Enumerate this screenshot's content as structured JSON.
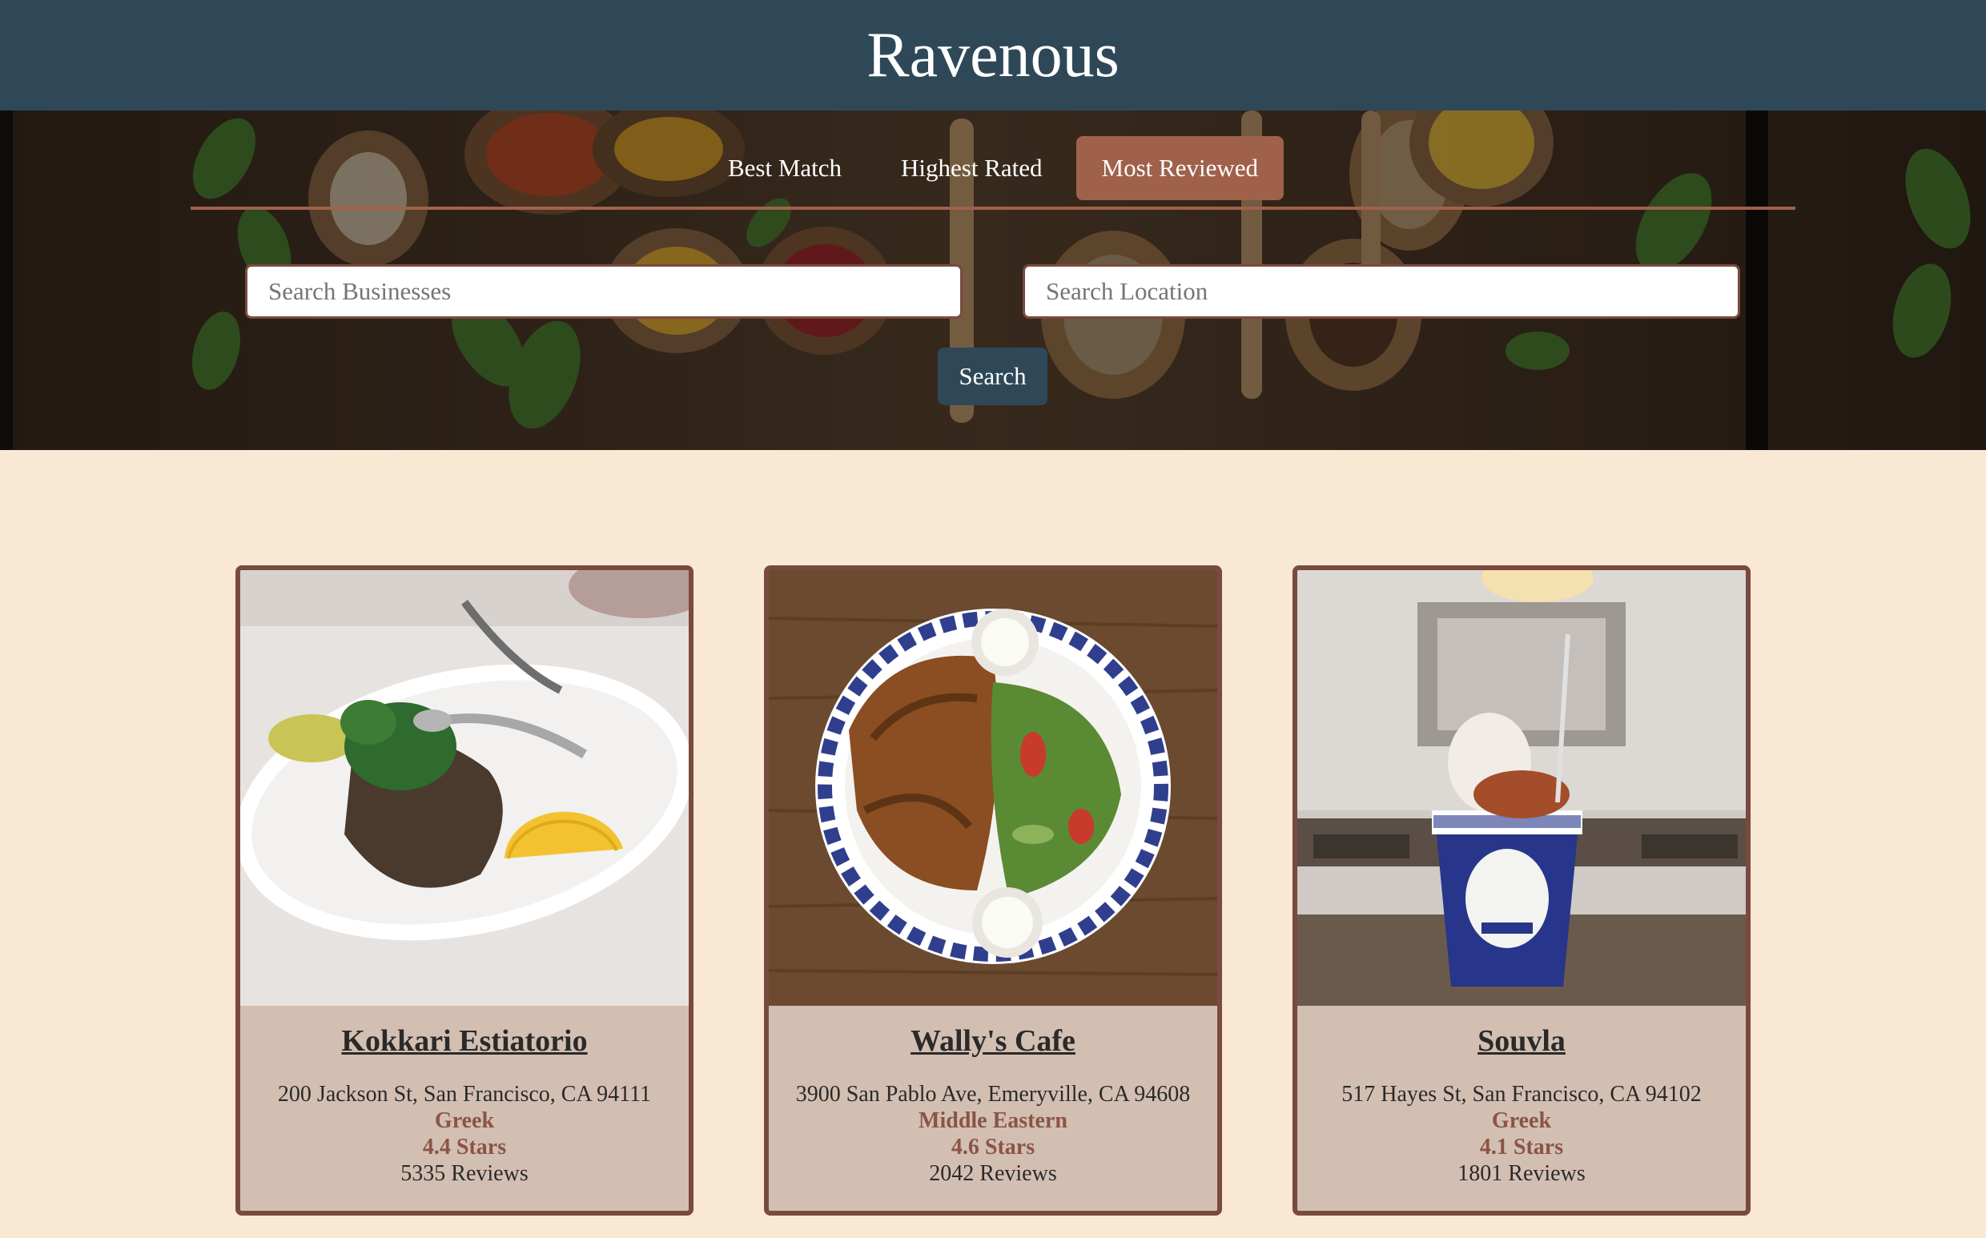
{
  "header": {
    "title": "Ravenous"
  },
  "sort_tabs": [
    {
      "label": "Best Match",
      "active": false
    },
    {
      "label": "Highest Rated",
      "active": false
    },
    {
      "label": "Most Reviewed",
      "active": true
    }
  ],
  "search": {
    "business_placeholder": "Search Businesses",
    "location_placeholder": "Search Location",
    "button_label": "Search"
  },
  "colors": {
    "header": "#2f4858",
    "accent": "#a0614b",
    "page_background": "#f8e8d4",
    "card_background": "#d3bfb2",
    "card_border": "#7a4a3e"
  },
  "businesses": [
    {
      "name": "Kokkari Estiatorio",
      "address": "200 Jackson St, San Francisco, CA 94111",
      "category": "Greek",
      "rating": "4.4 Stars",
      "reviews": "5335 Reviews",
      "image_icon": "grilled-skewers-photo"
    },
    {
      "name": "Wally's Cafe",
      "address": "3900 San Pablo Ave, Emeryville, CA 94608",
      "category": "Middle Eastern",
      "rating": "4.6 Stars",
      "reviews": "2042 Reviews",
      "image_icon": "chicken-salad-plate-photo"
    },
    {
      "name": "Souvla",
      "address": "517 Hayes St, San Francisco, CA 94102",
      "category": "Greek",
      "rating": "4.1 Stars",
      "reviews": "1801 Reviews",
      "image_icon": "frozen-yogurt-cup-photo"
    }
  ]
}
